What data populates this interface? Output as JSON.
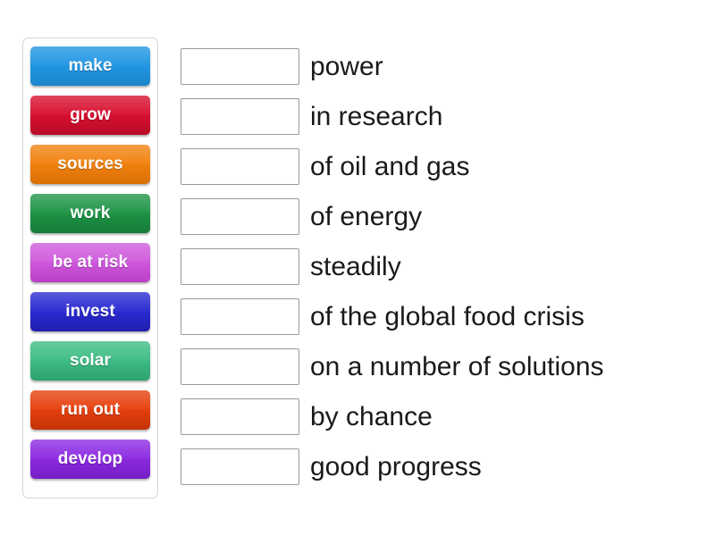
{
  "activity": {
    "type": "match-up",
    "title": "Energy collocations match-up"
  },
  "tiles_panel": {
    "name": "word-bank",
    "tiles": [
      {
        "label": "make",
        "color": "#2196e3",
        "color_dark": "#1b86cc"
      },
      {
        "label": "grow",
        "color": "#d81030",
        "color_dark": "#b80c26"
      },
      {
        "label": "sources",
        "color": "#f1820f",
        "color_dark": "#d96f06"
      },
      {
        "label": "work",
        "color": "#1f9547",
        "color_dark": "#157a38"
      },
      {
        "label": "be at risk",
        "color": "#cf5adc",
        "color_dark": "#b93ec6"
      },
      {
        "label": "invest",
        "color": "#2a2ad2",
        "color_dark": "#1f1fae"
      },
      {
        "label": "solar",
        "color": "#3dbd85",
        "color_dark": "#2ea26e"
      },
      {
        "label": "run out",
        "color": "#e6400d",
        "color_dark": "#c43308"
      },
      {
        "label": "develop",
        "color": "#8c2ae2",
        "color_dark": "#761fc4"
      }
    ]
  },
  "answers_panel": {
    "name": "answer-list",
    "rows": [
      {
        "answer": "",
        "phrase": "power"
      },
      {
        "answer": "",
        "phrase": "in research"
      },
      {
        "answer": "",
        "phrase": "of oil and gas"
      },
      {
        "answer": "",
        "phrase": "of energy"
      },
      {
        "answer": "",
        "phrase": "steadily"
      },
      {
        "answer": "",
        "phrase": "of the global food crisis"
      },
      {
        "answer": "",
        "phrase": "on a number of solutions"
      },
      {
        "answer": "",
        "phrase": "by chance"
      },
      {
        "answer": "",
        "phrase": "good progress"
      }
    ],
    "placeholder": ""
  },
  "colors": {
    "page_background": "#ffffff",
    "panel_border": "#d4d4d4",
    "box_border": "#9a9a9a",
    "text": "#1a1a1a",
    "tile_text": "#ffffff"
  }
}
